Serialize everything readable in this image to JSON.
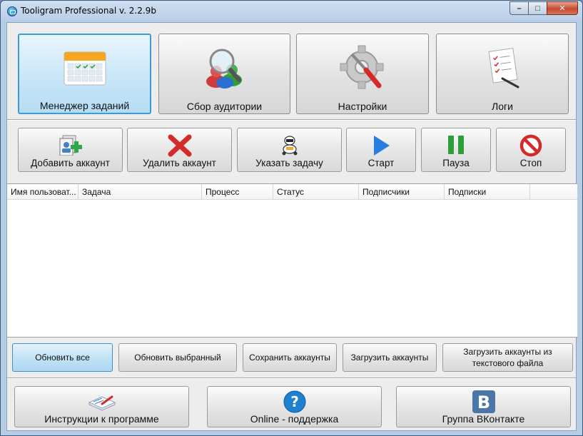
{
  "window": {
    "title": "Tooligram Professional v. 2.2.9b"
  },
  "modules": [
    {
      "label": "Менеджер заданий",
      "icon": "calendar-icon",
      "active": true
    },
    {
      "label": "Сбор аудитории",
      "icon": "audience-search-icon",
      "active": false
    },
    {
      "label": "Настройки",
      "icon": "settings-gear-icon",
      "active": false
    },
    {
      "label": "Логи",
      "icon": "logs-checklist-icon",
      "active": false
    }
  ],
  "toolbar": {
    "add_account": "Добавить аккаунт",
    "delete_account": "Удалить аккаунт",
    "set_task": "Указать задачу",
    "start": "Старт",
    "pause": "Пауза",
    "stop": "Стоп"
  },
  "table": {
    "columns": [
      "Имя пользоват...",
      "Задача",
      "Процесс",
      "Статус",
      "Подписчики",
      "Подписки"
    ],
    "rows": []
  },
  "actions": {
    "refresh_all": "Обновить все",
    "refresh_selected": "Обновить выбранный",
    "save_accounts": "Сохранить аккаунты",
    "load_accounts": "Загрузить аккаунты",
    "load_from_file": "Загрузить аккаунты из текстового файла"
  },
  "links": {
    "instructions": "Инструкции к программе",
    "support": "Online - поддержка",
    "vk_group": "Группа ВКонтакте"
  },
  "colors": {
    "accent": "#3c9ad7",
    "delete_red": "#d42a2a",
    "start_blue": "#2a7de0",
    "pause_green": "#2e9e3a"
  }
}
